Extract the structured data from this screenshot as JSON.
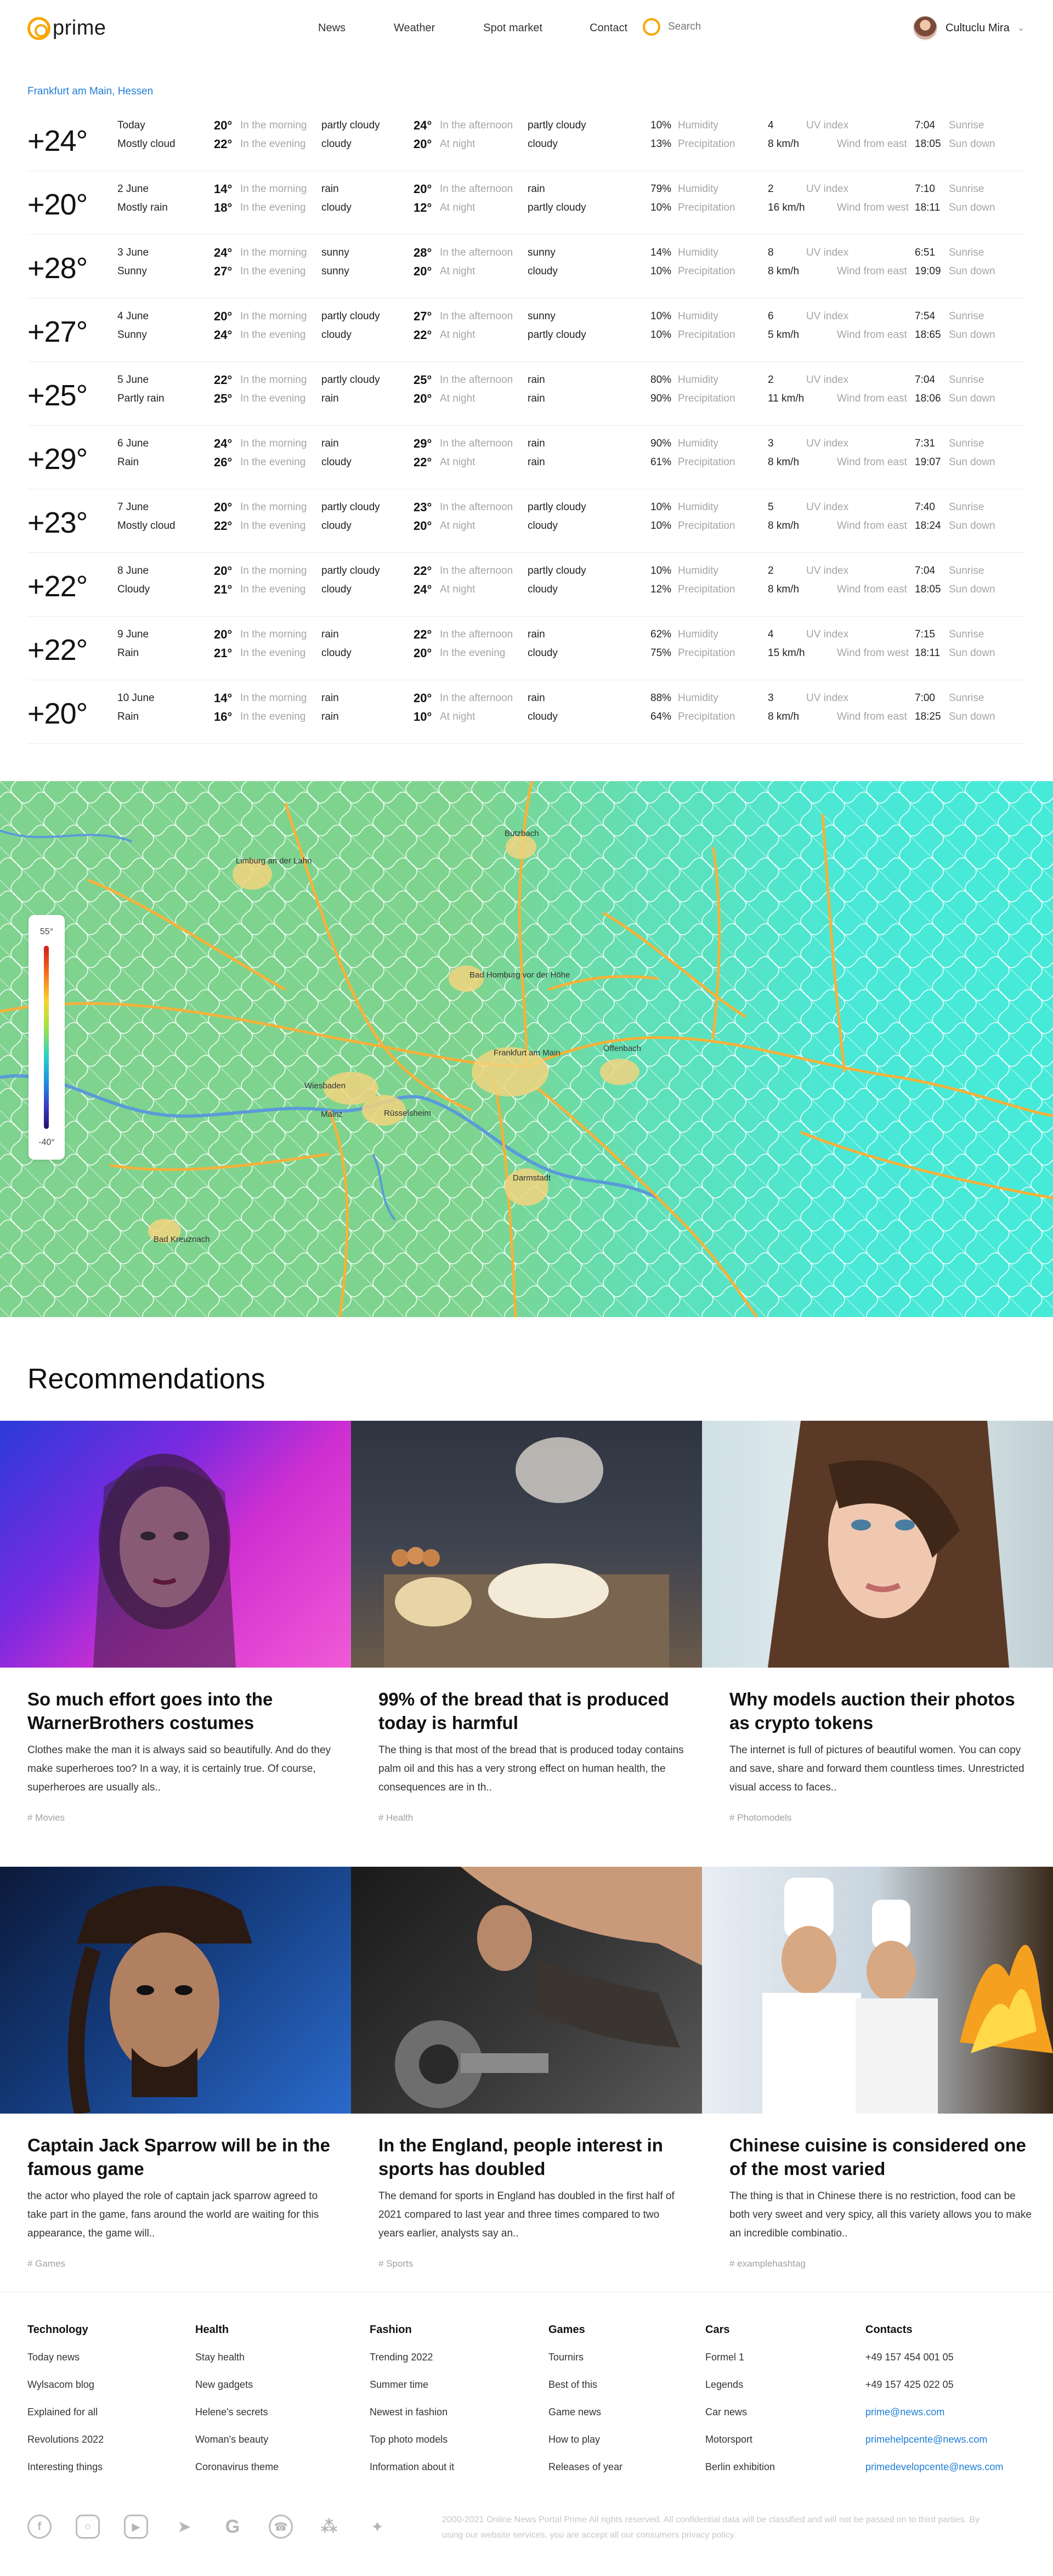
{
  "header": {
    "logo_text": "prime",
    "nav": [
      "News",
      "Weather",
      "Spot market",
      "Contact"
    ],
    "search_placeholder": "Search",
    "user_name": "Cultuclu Mira"
  },
  "weather": {
    "location": "Frankfurt am Main, Hessen",
    "labels": {
      "morning": "In the morning",
      "evening": "In the evening",
      "afternoon": "In the afternoon",
      "night": "At night",
      "humidity": "Humidity",
      "precipitation": "Precipitation",
      "uv": "UV index",
      "sunrise": "Sunrise",
      "sundown": "Sun down"
    },
    "days": [
      {
        "temp": "+24°",
        "day": "Today",
        "cond": "Mostly cloud",
        "m_t": "20°",
        "m_c": "partly cloudy",
        "e_t": "22°",
        "e_c": "cloudy",
        "a_t": "24°",
        "a_c": "partly cloudy",
        "n_t": "20°",
        "n_c": "cloudy",
        "second_label": "night",
        "hum": "10%",
        "prec": "13%",
        "uv": "4",
        "wind": "8 km/h",
        "wind_dir": "Wind from east",
        "sunrise": "7:04",
        "sundown": "18:05"
      },
      {
        "temp": "+20°",
        "day": "2 June",
        "cond": "Mostly rain",
        "m_t": "14°",
        "m_c": "rain",
        "e_t": "18°",
        "e_c": "cloudy",
        "a_t": "20°",
        "a_c": "rain",
        "n_t": "12°",
        "n_c": "partly cloudy",
        "second_label": "night",
        "hum": "79%",
        "prec": "10%",
        "uv": "2",
        "wind": "16 km/h",
        "wind_dir": "Wind from west",
        "sunrise": "7:10",
        "sundown": "18:11"
      },
      {
        "temp": "+28°",
        "day": "3 June",
        "cond": "Sunny",
        "m_t": "24°",
        "m_c": "sunny",
        "e_t": "27°",
        "e_c": "sunny",
        "a_t": "28°",
        "a_c": "sunny",
        "n_t": "20°",
        "n_c": "cloudy",
        "second_label": "night",
        "hum": "14%",
        "prec": "10%",
        "uv": "8",
        "wind": "8 km/h",
        "wind_dir": "Wind from east",
        "sunrise": "6:51",
        "sundown": "19:09"
      },
      {
        "temp": "+27°",
        "day": "4 June",
        "cond": "Sunny",
        "m_t": "20°",
        "m_c": "partly cloudy",
        "e_t": "24°",
        "e_c": "cloudy",
        "a_t": "27°",
        "a_c": "sunny",
        "n_t": "22°",
        "n_c": "partly cloudy",
        "second_label": "night",
        "hum": "10%",
        "prec": "10%",
        "uv": "6",
        "wind": "5 km/h",
        "wind_dir": "Wind from east",
        "sunrise": "7:54",
        "sundown": "18:65"
      },
      {
        "temp": "+25°",
        "day": "5 June",
        "cond": "Partly rain",
        "m_t": "22°",
        "m_c": "partly cloudy",
        "e_t": "25°",
        "e_c": "rain",
        "a_t": "25°",
        "a_c": "rain",
        "n_t": "20°",
        "n_c": "rain",
        "second_label": "night",
        "hum": "80%",
        "prec": "90%",
        "uv": "2",
        "wind": "11 km/h",
        "wind_dir": "Wind from east",
        "sunrise": "7:04",
        "sundown": "18:06"
      },
      {
        "temp": "+29°",
        "day": "6 June",
        "cond": "Rain",
        "m_t": "24°",
        "m_c": "rain",
        "e_t": "26°",
        "e_c": "cloudy",
        "a_t": "29°",
        "a_c": "rain",
        "n_t": "22°",
        "n_c": "rain",
        "second_label": "night",
        "hum": "90%",
        "prec": "61%",
        "uv": "3",
        "wind": "8 km/h",
        "wind_dir": "Wind from east",
        "sunrise": "7:31",
        "sundown": "19:07"
      },
      {
        "temp": "+23°",
        "day": "7 June",
        "cond": "Mostly cloud",
        "m_t": "20°",
        "m_c": "partly cloudy",
        "e_t": "22°",
        "e_c": "cloudy",
        "a_t": "23°",
        "a_c": "partly cloudy",
        "n_t": "20°",
        "n_c": "cloudy",
        "second_label": "night",
        "hum": "10%",
        "prec": "10%",
        "uv": "5",
        "wind": "8 km/h",
        "wind_dir": "Wind from east",
        "sunrise": "7:40",
        "sundown": "18:24"
      },
      {
        "temp": "+22°",
        "day": "8 June",
        "cond": "Cloudy",
        "m_t": "20°",
        "m_c": "partly cloudy",
        "e_t": "21°",
        "e_c": "cloudy",
        "a_t": "22°",
        "a_c": "partly cloudy",
        "n_t": "24°",
        "n_c": "cloudy",
        "second_label": "night",
        "hum": "10%",
        "prec": "12%",
        "uv": "2",
        "wind": "8 km/h",
        "wind_dir": "Wind from east",
        "sunrise": "7:04",
        "sundown": "18:05"
      },
      {
        "temp": "+22°",
        "day": "9 June",
        "cond": "Rain",
        "m_t": "20°",
        "m_c": "rain",
        "e_t": "21°",
        "e_c": "cloudy",
        "a_t": "22°",
        "a_c": "rain",
        "n_t": "20°",
        "n_c": "cloudy",
        "second_label": "evening",
        "hum": "62%",
        "prec": "75%",
        "uv": "4",
        "wind": "15 km/h",
        "wind_dir": "Wind from west",
        "sunrise": "7:15",
        "sundown": "18:11"
      },
      {
        "temp": "+20°",
        "day": "10 June",
        "cond": "Rain",
        "m_t": "14°",
        "m_c": "rain",
        "e_t": "16°",
        "e_c": "rain",
        "a_t": "20°",
        "a_c": "rain",
        "n_t": "10°",
        "n_c": "cloudy",
        "second_label": "night",
        "hum": "88%",
        "prec": "64%",
        "uv": "3",
        "wind": "8 km/h",
        "wind_dir": "Wind from east",
        "sunrise": "7:00",
        "sundown": "18:25"
      }
    ]
  },
  "map": {
    "legend_max": "55°",
    "legend_min": "-40°",
    "city_labels": [
      {
        "name": "Frankfurt am Main"
      },
      {
        "name": "Wiesbaden"
      },
      {
        "name": "Mainz"
      },
      {
        "name": "Darmstadt"
      },
      {
        "name": "Bad Homburg vor der Höhe"
      },
      {
        "name": "Offenbach"
      },
      {
        "name": "Rüsselsheim"
      },
      {
        "name": "Bad Kreuznach"
      },
      {
        "name": "Butzbach"
      },
      {
        "name": "Limburg an der Lahn"
      }
    ]
  },
  "recommendations": {
    "title": "Recommendations",
    "cards": [
      {
        "title": "So much effort goes into the WarnerBrothers costumes",
        "desc": "Clothes make the man it is always said so beautifully. And do they make superheroes too? In a way, it is certainly true. Of course, superheroes are usually als..",
        "tag": "# Movies"
      },
      {
        "title": "99% of the bread that is produced today is harmful",
        "desc": "The thing is that most of the bread that is produced today contains palm oil and this has a very strong effect on human health, the consequences are in th..",
        "tag": "# Health"
      },
      {
        "title": "Why models auction their photos as crypto tokens",
        "desc": "The internet is full of pictures of beautiful women. You can copy and save, share and forward them countless times. Unrestricted visual access to faces..",
        "tag": "# Photomodels"
      },
      {
        "title": "Captain Jack Sparrow will be in the famous game",
        "desc": "the actor who played the role of captain jack sparrow agreed to take part in the game, fans around the world are waiting for this appearance, the game will..",
        "tag": "# Games"
      },
      {
        "title": "In the England, people interest in sports has doubled",
        "desc": "The demand for sports in England has doubled in the first half of 2021 compared to last year and three times compared to two years earlier, analysts say an..",
        "tag": "# Sports"
      },
      {
        "title": "Chinese cuisine is considered one of the most varied",
        "desc": "The thing is that in Chinese there is no restriction, food can be both very sweet and very spicy, all this variety allows you to make an incredible combinatio..",
        "tag": "# examplehashtag"
      }
    ]
  },
  "footer": {
    "columns": [
      {
        "heading": "Technology",
        "links": [
          "Today news",
          "Wylsacom blog",
          "Explained for all",
          "Revolutions 2022",
          "Interesting things"
        ]
      },
      {
        "heading": "Health",
        "links": [
          "Stay health",
          "New gadgets",
          "Helene's secrets",
          "Woman's beauty",
          "Coronavirus theme"
        ]
      },
      {
        "heading": "Fashion",
        "links": [
          "Trending 2022",
          "Summer time",
          "Newest in fashion",
          "Top photo models",
          "Information about it"
        ]
      },
      {
        "heading": "Games",
        "links": [
          "Tournirs",
          "Best of this",
          "Game news",
          "How to play",
          "Releases of year"
        ]
      },
      {
        "heading": "Cars",
        "links": [
          "Formel 1",
          "Legends",
          "Car news",
          "Motorsport",
          "Berlin exhibition"
        ]
      },
      {
        "heading": "Contacts",
        "links": [
          "+49 157 454 001 05",
          "+49 157 425 022 05",
          "prime@news.com",
          "primehelpcente@news.com",
          "primedevelopcente@news.com"
        ]
      }
    ],
    "socials": [
      "facebook-icon",
      "instagram-icon",
      "youtube-icon",
      "telegram-icon",
      "google-icon",
      "whatsapp-icon",
      "rss-icon",
      "twitter-icon"
    ],
    "copyright": "2000-2021 Online News Portal Prime All rights reserved. All confidential data will be classified and will not be passed on to third parties. By using our website services, you are accept all our consumers privacy policy."
  },
  "colors": {
    "accent": "#f7a707",
    "link": "#1f7ed6",
    "muted": "#a5a5a5"
  }
}
